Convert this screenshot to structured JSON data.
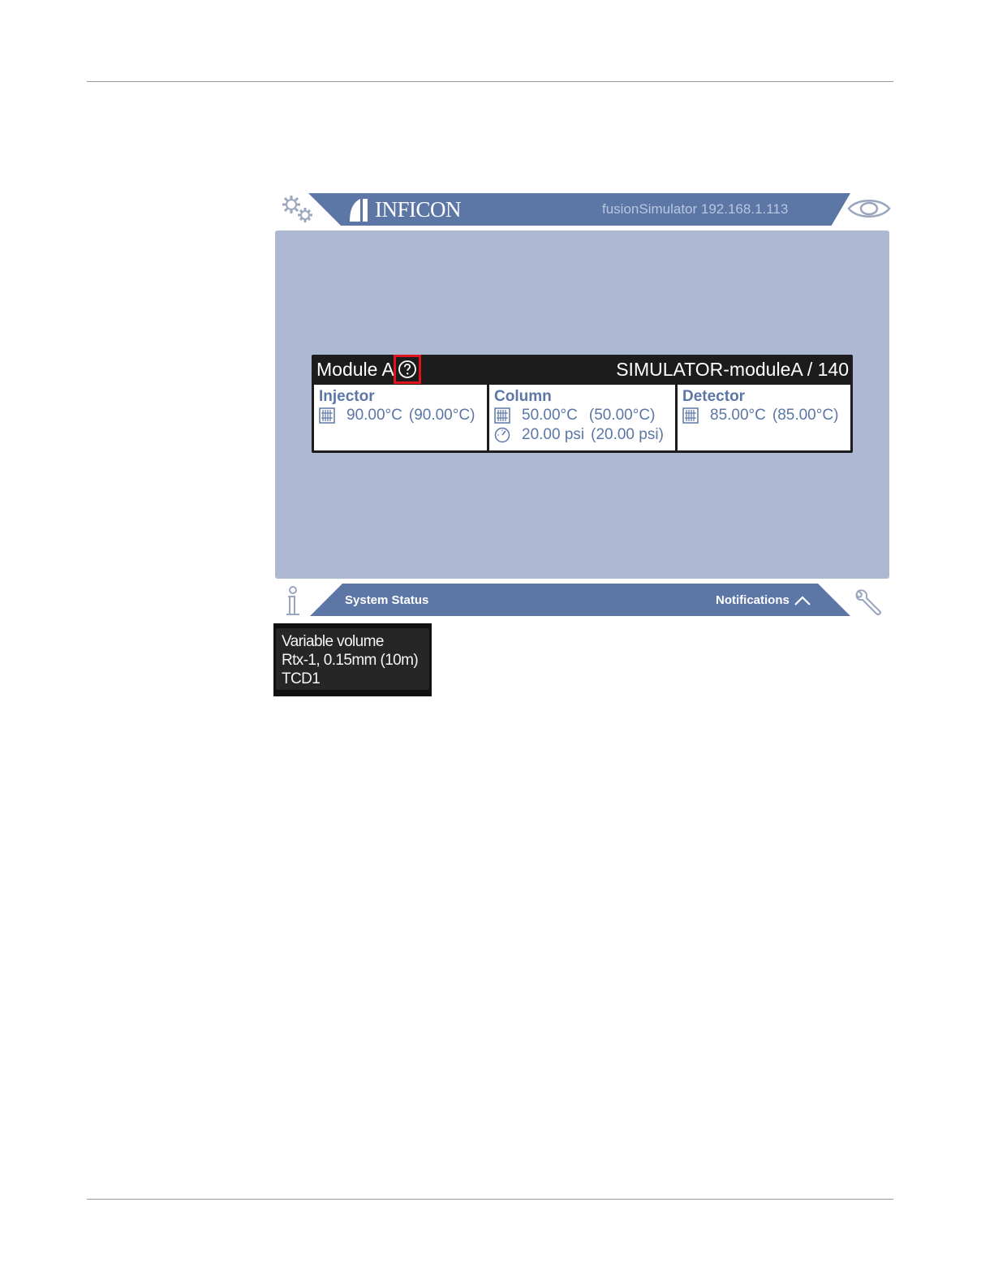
{
  "header": {
    "brand": "INFICON",
    "device_label": "fusionSimulator 192.168.1.113"
  },
  "module": {
    "name": "Module A",
    "id_label": "SIMULATOR-moduleA / 140",
    "injector": {
      "title": "Injector",
      "temp_actual": "90.00°C",
      "temp_setpoint": "(90.00°C)"
    },
    "column": {
      "title": "Column",
      "temp_actual": "50.00°C",
      "temp_setpoint": "(50.00°C)",
      "pressure_actual": "20.00 psi",
      "pressure_setpoint": "(20.00 psi)"
    },
    "detector": {
      "title": "Detector",
      "temp_actual": "85.00°C",
      "temp_setpoint": "(85.00°C)"
    }
  },
  "footer": {
    "system_status": "System Status",
    "notifications": "Notifications"
  },
  "tooltip": {
    "lines": [
      "Variable volume",
      "Rtx-1, 0.15mm (10m)",
      "TCD1"
    ]
  },
  "colors": {
    "bar": "#5c76a6",
    "panel": "#adb8d3",
    "highlight": "#e0121b"
  }
}
